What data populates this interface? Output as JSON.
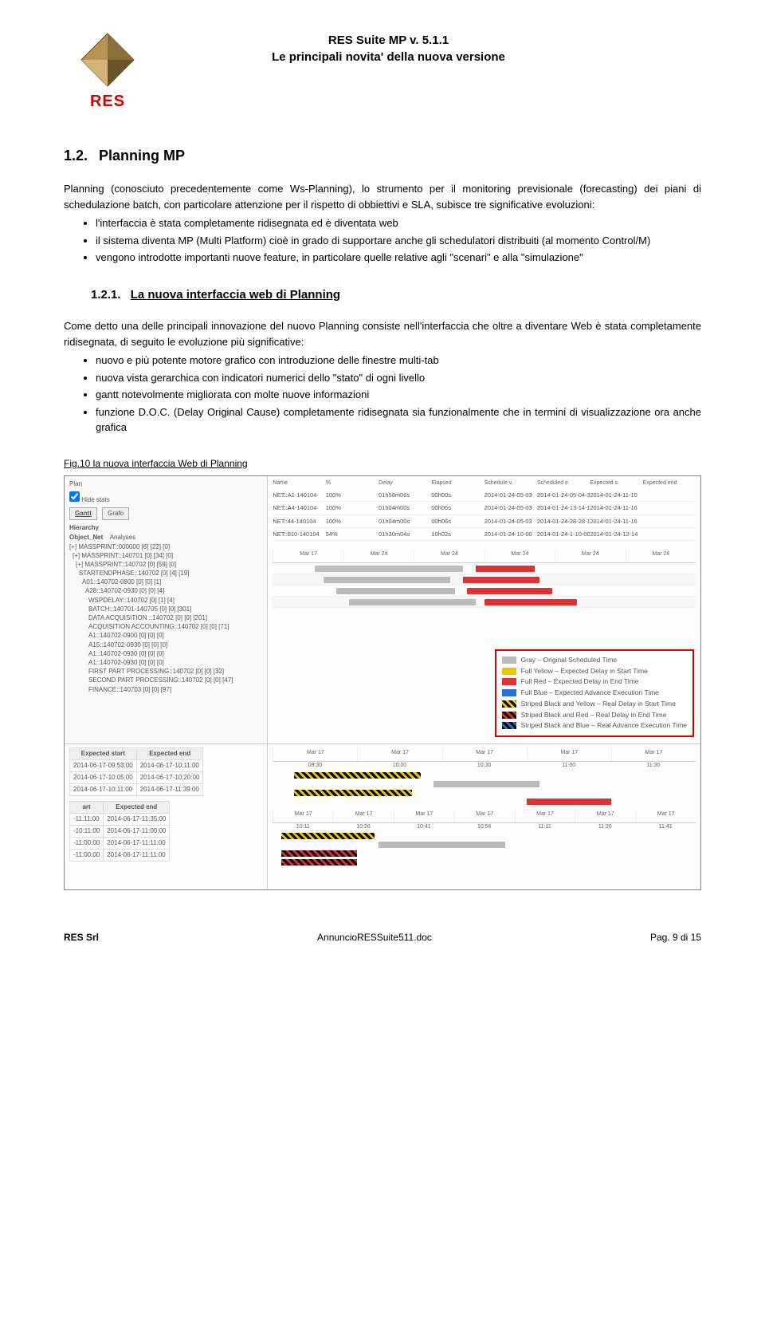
{
  "header": {
    "logo_text": "RES",
    "title_line1": "RES Suite MP v. 5.1.1",
    "title_line2": "Le principali novita' della nuova versione"
  },
  "section": {
    "number": "1.2.",
    "title": "Planning MP",
    "intro": "Planning (conosciuto precedentemente come Ws-Planning), lo strumento per il monitoring previsionale (forecasting) dei piani di schedulazione batch, con particolare attenzione per il rispetto di obbiettivi e SLA, subisce tre significative evoluzioni:",
    "bullets": [
      "l'interfaccia è stata completamente ridisegnata ed è diventata web",
      "il sistema diventa MP (Multi Platform) cioè in grado di supportare anche gli schedulatori distribuiti (al momento Control/M)",
      "vengono introdotte importanti nuove feature, in particolare quelle relative agli \"scenari\" e alla \"simulazione\""
    ]
  },
  "subsection": {
    "number": "1.2.1.",
    "title": "La nuova interfaccia web di Planning",
    "intro": "Come detto una delle principali innovazione del nuovo Planning consiste nell'interfaccia che oltre a diventare Web è stata completamente ridisegnata, di seguito le evoluzione più significative:",
    "bullets": [
      "nuovo e più potente motore grafico con introduzione delle finestre multi-tab",
      "nuova vista gerarchica con indicatori numerici dello \"stato\" di ogni livello",
      "gantt notevolmente migliorata con molte nuove informazioni",
      "funzione D.O.C. (Delay Original Cause) completamente ridisegnata sia funzionalmente che in termini di visualizzazione ora anche grafica"
    ],
    "figure_caption": "Fig.10 la nuova interfaccia Web di Planning"
  },
  "screenshot": {
    "plan_label": "Plan",
    "hide_stats": "Hide stats",
    "tabs": [
      "Gantt",
      "Grafo"
    ],
    "tree_header": "Hierarchy",
    "object_net": "Object_Net",
    "analyses": "Analyses",
    "tree": [
      "MASSPRINT::000000 [6] [22] [0]",
      "MASSPRINT::140701 [0] [34] [0]",
      "MASSPRINT::140702 [0] [59] [0]",
      "STARTENDPHASE::140702 [0] [4] [19]",
      "A01::140702-0800 [0] [0] [1]",
      "A28::140702-0930 [0] [0] [4]",
      "WSPDELAY::140702 [0] [1] [4]",
      "BATCH::140701-140705 [0] [0] [301]",
      "DATA ACQUISITION ::140702 [0] [0] [201]",
      "ACQUISITION ACCOUNTING::140702 [0] [0] [71]",
      "A1::140702-0900 [0] [0] [0]",
      "A15::140702-0930 [0] [0] [0]",
      "A1::140702-0930 [0] [0] [0]",
      "A1::140702-0930 [0] [0] [0]",
      "FIRST PART PROCESSING::140702 [0] [0] [32]",
      "SECOND PART PROCESSING::140702 [0] [0] [47]",
      "FINANCE::140703 [0] [0] [97]"
    ],
    "grid_headers": [
      "Name",
      "%",
      "Delay",
      "Elapsed",
      "Schedule v.",
      "Scheduled e.",
      "Expected s.",
      "Expected end"
    ],
    "grid_rows": [
      {
        "name": "NET::A1-140104",
        "pct": "100%",
        "d": "01h58m06s",
        "e": "00h00s",
        "s1": "2014-01-24-05-03",
        "s2": "2014-01-24-05-04-3",
        "s3": "2014-01-24-11-10"
      },
      {
        "name": "NET::A4-140104",
        "pct": "100%",
        "d": "01h04m00s",
        "e": "00h06s",
        "s1": "2014-01-24-05-03",
        "s2": "2014-01-24-13-14-1",
        "s3": "2014-01-24-11-16"
      },
      {
        "name": "NET::44-140104",
        "pct": "100%",
        "d": "01h04m00s",
        "e": "00h06s",
        "s1": "2014-01-24-05-03",
        "s2": "2014-01-24-28-28-1",
        "s3": "2014-01-24-11-16"
      },
      {
        "name": "NET::810-140104",
        "pct": "54%",
        "d": "01h30m04s",
        "e": "10h02s",
        "s1": "2014-01-24-10-00",
        "s2": "2014-01-24-1-10-00",
        "s3": "2014-01-24-12-14"
      }
    ],
    "time_ticks": [
      "Mar 17",
      "Mar 24",
      "Mar 24",
      "Mar 24",
      "Mar 24",
      "Mar 24"
    ],
    "bottom_times": [
      "09:30",
      "10:00",
      "10:30",
      "11:00",
      "11:30"
    ],
    "bottom_times2": [
      "10:11",
      "10:26",
      "10:41",
      "10:56",
      "11:11",
      "11:26",
      "11:41"
    ],
    "table1": {
      "headers": [
        "Expected start",
        "Expected end"
      ],
      "rows": [
        [
          "2014-06-17-09:53:00",
          "2014-06-17-10:11:00"
        ],
        [
          "2014-06-17-10:05:00",
          "2014-06-17-10:20:00"
        ],
        [
          "2014-06-17-10:11:00",
          "2014-06-17-11:39:00"
        ]
      ]
    },
    "table2": {
      "headers": [
        "art",
        "Expected end"
      ],
      "rows": [
        [
          "-11:11:00",
          "2014-06-17-11:35:00"
        ],
        [
          "-10:11:00",
          "2014-06-17-11:00:00"
        ],
        [
          "-11:00:00",
          "2014-06-17-11:11:00"
        ],
        [
          "-11:00:00",
          "2014-06-17-11:11:00"
        ]
      ]
    },
    "legend": [
      {
        "cls": "gray",
        "label": "Gray – Original Scheduled Time"
      },
      {
        "cls": "yellow",
        "label": "Full Yellow – Expected Delay in Start Time"
      },
      {
        "cls": "red",
        "label": "Full Red – Expected Delay in End Time"
      },
      {
        "cls": "blue",
        "label": "Full Blue – Expected Advance Execution Time"
      },
      {
        "cls": "stripe-by",
        "label": "Striped Black and Yellow – Real Delay in Start Time"
      },
      {
        "cls": "stripe-br",
        "label": "Striped Black and Red – Real Delay in End Time"
      },
      {
        "cls": "stripe-bb",
        "label": "Striped Black and Blue – Real Advance Execution Time"
      }
    ]
  },
  "footer": {
    "left": "RES Srl",
    "center": "AnnuncioRESSuite511.doc",
    "right": "Pag. 9 di 15"
  }
}
